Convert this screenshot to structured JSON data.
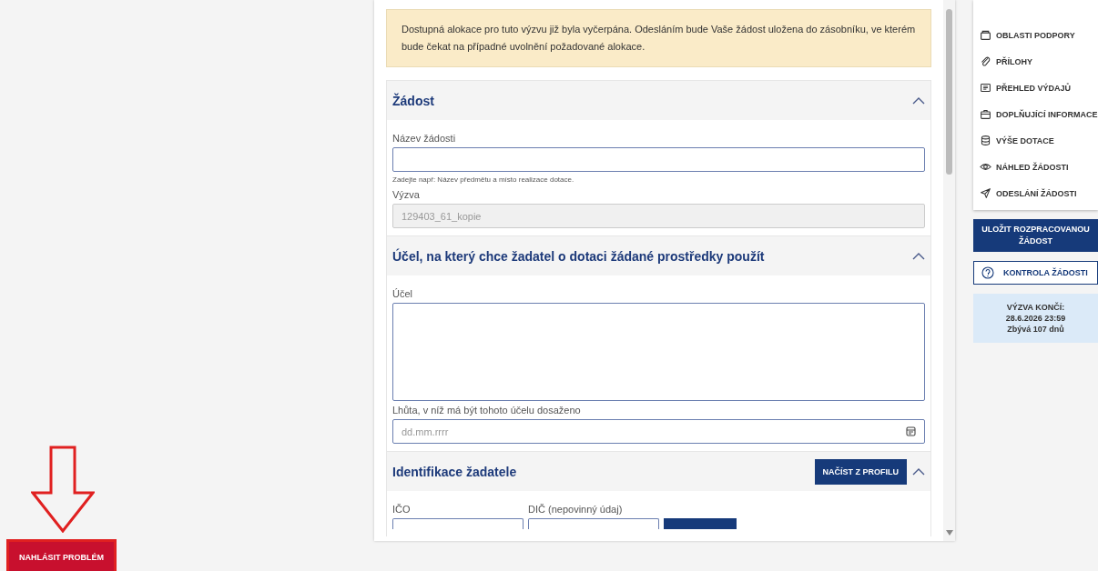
{
  "alert": {
    "text": "Dostupná alokace pro tuto výzvu již byla vyčerpána. Odesláním bude Vaše žádost uložena do zásobníku, ve kterém bude čekat na případné uvolnění požadované alokace."
  },
  "sections": [
    {
      "title": "Žádost",
      "expanded": true,
      "fields": [
        {
          "kind": "input",
          "label": "Název žádosti",
          "hint": "Zadejte např: Název předmětu a místo realizace dotace.",
          "disabled": false
        },
        {
          "kind": "input",
          "label": "Výzva",
          "value": "129403_61_kopie",
          "disabled": true
        }
      ]
    },
    {
      "title": "Účel, na který chce žadatel o dotaci žádané prostředky použít",
      "expanded": true,
      "fields": [
        {
          "kind": "textarea",
          "label": "Účel"
        },
        {
          "kind": "date",
          "label": "Lhůta, v níž má být tohoto účelu dosaženo",
          "placeholder": "dd.mm.rrrr"
        }
      ]
    },
    {
      "title": "Identifikace žadatele",
      "expanded": true,
      "action": "NAČÍST Z PROFILU",
      "fields": [
        {
          "kind": "inline",
          "label": "IČO"
        },
        {
          "kind": "inline",
          "label": "DIČ (nepovinný údaj)"
        }
      ]
    }
  ],
  "nav": [
    {
      "label": "OBLASTI PODPORY"
    },
    {
      "label": "PŘÍLOHY"
    },
    {
      "label": "PŘEHLED VÝDAJŮ"
    },
    {
      "label": "DOPLŇUJÍCÍ INFORMACE"
    },
    {
      "label": "VÝŠE DOTACE"
    },
    {
      "label": "NÁHLED ŽÁDOSTI"
    },
    {
      "label": "ODESLÁNÍ ŽÁDOSTI"
    }
  ],
  "save_button": "ULOŽIT ROZPRACOVANOU ŽÁDOST",
  "check_button": "KONTROLA ŽÁDOSTI",
  "deadline": [
    "VÝZVA KONČÍ:",
    "28.6.2026 23:59",
    "Zbývá 107 dnů"
  ],
  "report_button": "NAHLÁSIT PROBLÉM"
}
